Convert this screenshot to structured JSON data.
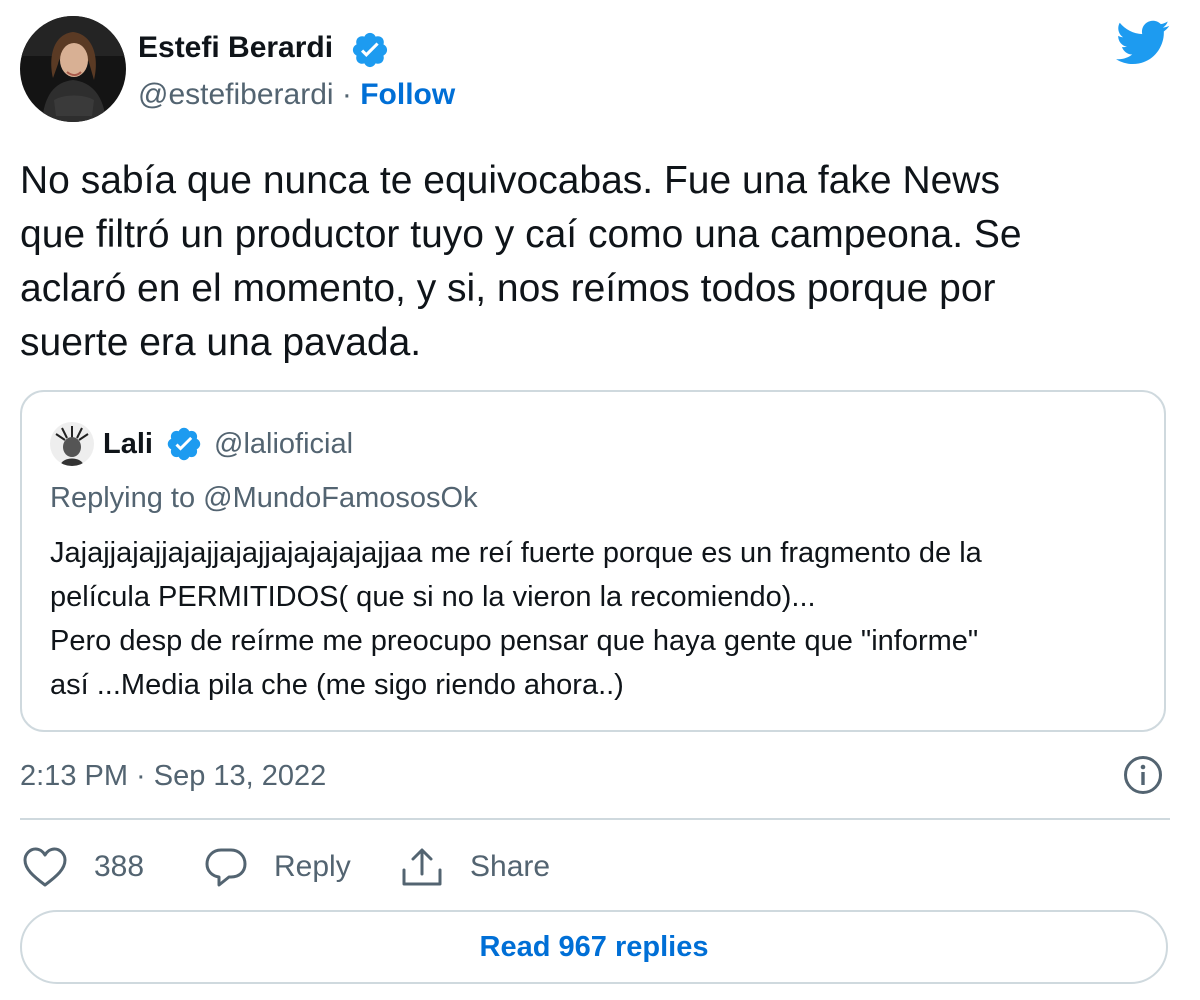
{
  "tweet": {
    "author": {
      "name": "Estefi Berardi",
      "handle": "@estefiberardi",
      "separator": "·",
      "follow_label": "Follow",
      "verified": true
    },
    "text": "No sabía que nunca te equivocabas. Fue una fake News\nque filtró un productor tuyo y caí como una campeona. Se\naclaró en el momento, y si, nos reímos todos porque por\nsuerte era una pavada.",
    "quoted_tweet": {
      "name": "Lali",
      "handle": "@lalioficial",
      "verified": true,
      "replying_to": "Replying to @MundoFamososOk",
      "text": "Jajajjajajjajajjajajjajajajajajjaa me reí fuerte porque es un fragmento de la\npelícula PERMITIDOS( que si no la vieron la recomiendo)...\nPero desp de reírme me preocupo pensar que haya gente que \"informe\"\nasí ...Media pila che (me sigo riendo ahora..)"
    },
    "timestamp": "2:13 PM · Sep 13, 2022",
    "actions": {
      "like_count": "388",
      "reply_label": "Reply",
      "share_label": "Share"
    },
    "read_replies_label": "Read 967 replies"
  },
  "icons": {
    "brand": "twitter-bird-icon",
    "verified": "verified-badge-icon",
    "info": "info-icon",
    "like": "heart-icon",
    "reply": "speech-bubble-icon",
    "share": "share-upload-icon"
  },
  "colors": {
    "brand_blue": "#1d9bf0",
    "link_blue": "#006fd6",
    "text": "#0f1419",
    "secondary_text": "#536471",
    "border": "#cfd9de"
  }
}
